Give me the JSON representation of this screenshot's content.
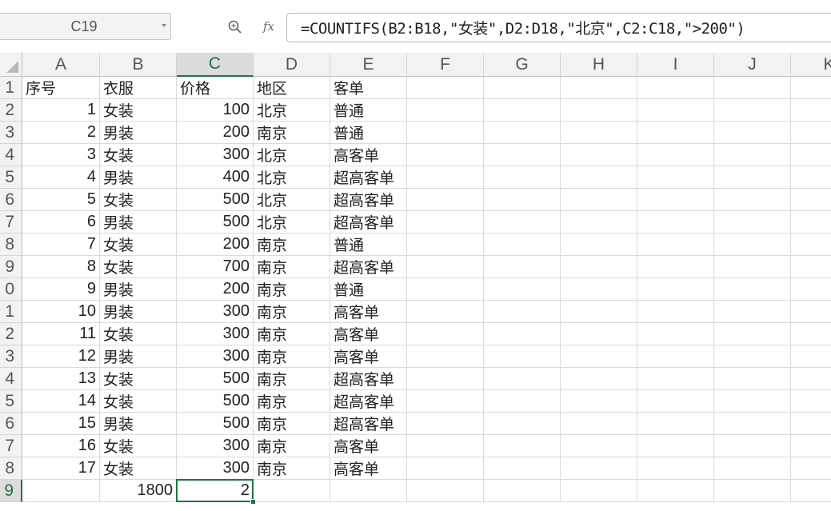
{
  "formula_bar": {
    "name_box": "C19",
    "fx_label": "fx",
    "formula": "=COUNTIFS(B2:B18,\"女装\",D2:D18,\"北京\",C2:C18,\">200\")"
  },
  "sheet": {
    "columns": [
      "A",
      "B",
      "C",
      "D",
      "E",
      "F",
      "G",
      "H",
      "I",
      "J",
      "K"
    ],
    "selected_column": "C",
    "row_labels": [
      "1",
      "2",
      "3",
      "4",
      "5",
      "6",
      "7",
      "8",
      "9",
      "0",
      "1",
      "2",
      "3",
      "4",
      "5",
      "6",
      "7",
      "8",
      "9"
    ],
    "selected_row_index": 18,
    "headers": [
      "序号",
      "衣服",
      "价格",
      "地区",
      "客单"
    ],
    "rows": [
      [
        "1",
        "女装",
        "100",
        "北京",
        "普通"
      ],
      [
        "2",
        "男装",
        "200",
        "南京",
        "普通"
      ],
      [
        "3",
        "女装",
        "300",
        "北京",
        "高客单"
      ],
      [
        "4",
        "男装",
        "400",
        "北京",
        "超高客单"
      ],
      [
        "5",
        "女装",
        "500",
        "北京",
        "超高客单"
      ],
      [
        "6",
        "男装",
        "500",
        "北京",
        "超高客单"
      ],
      [
        "7",
        "女装",
        "200",
        "南京",
        "普通"
      ],
      [
        "8",
        "女装",
        "700",
        "南京",
        "超高客单"
      ],
      [
        "9",
        "男装",
        "200",
        "南京",
        "普通"
      ],
      [
        "10",
        "男装",
        "300",
        "南京",
        "高客单"
      ],
      [
        "11",
        "女装",
        "300",
        "南京",
        "高客单"
      ],
      [
        "12",
        "男装",
        "300",
        "南京",
        "高客单"
      ],
      [
        "13",
        "女装",
        "500",
        "南京",
        "超高客单"
      ],
      [
        "14",
        "女装",
        "500",
        "南京",
        "超高客单"
      ],
      [
        "15",
        "男装",
        "500",
        "南京",
        "超高客单"
      ],
      [
        "16",
        "女装",
        "300",
        "南京",
        "高客单"
      ],
      [
        "17",
        "女装",
        "300",
        "南京",
        "高客单"
      ]
    ],
    "summary_row": [
      "",
      "1800",
      "2",
      "",
      ""
    ],
    "active_cell": "C19",
    "accent_color": "#217346"
  },
  "icons": {
    "zoom": "zoom-formula-icon",
    "fx": "function-fx-icon",
    "dropdown": "chevron-down-icon",
    "select_all": "select-all-triangle-icon"
  }
}
